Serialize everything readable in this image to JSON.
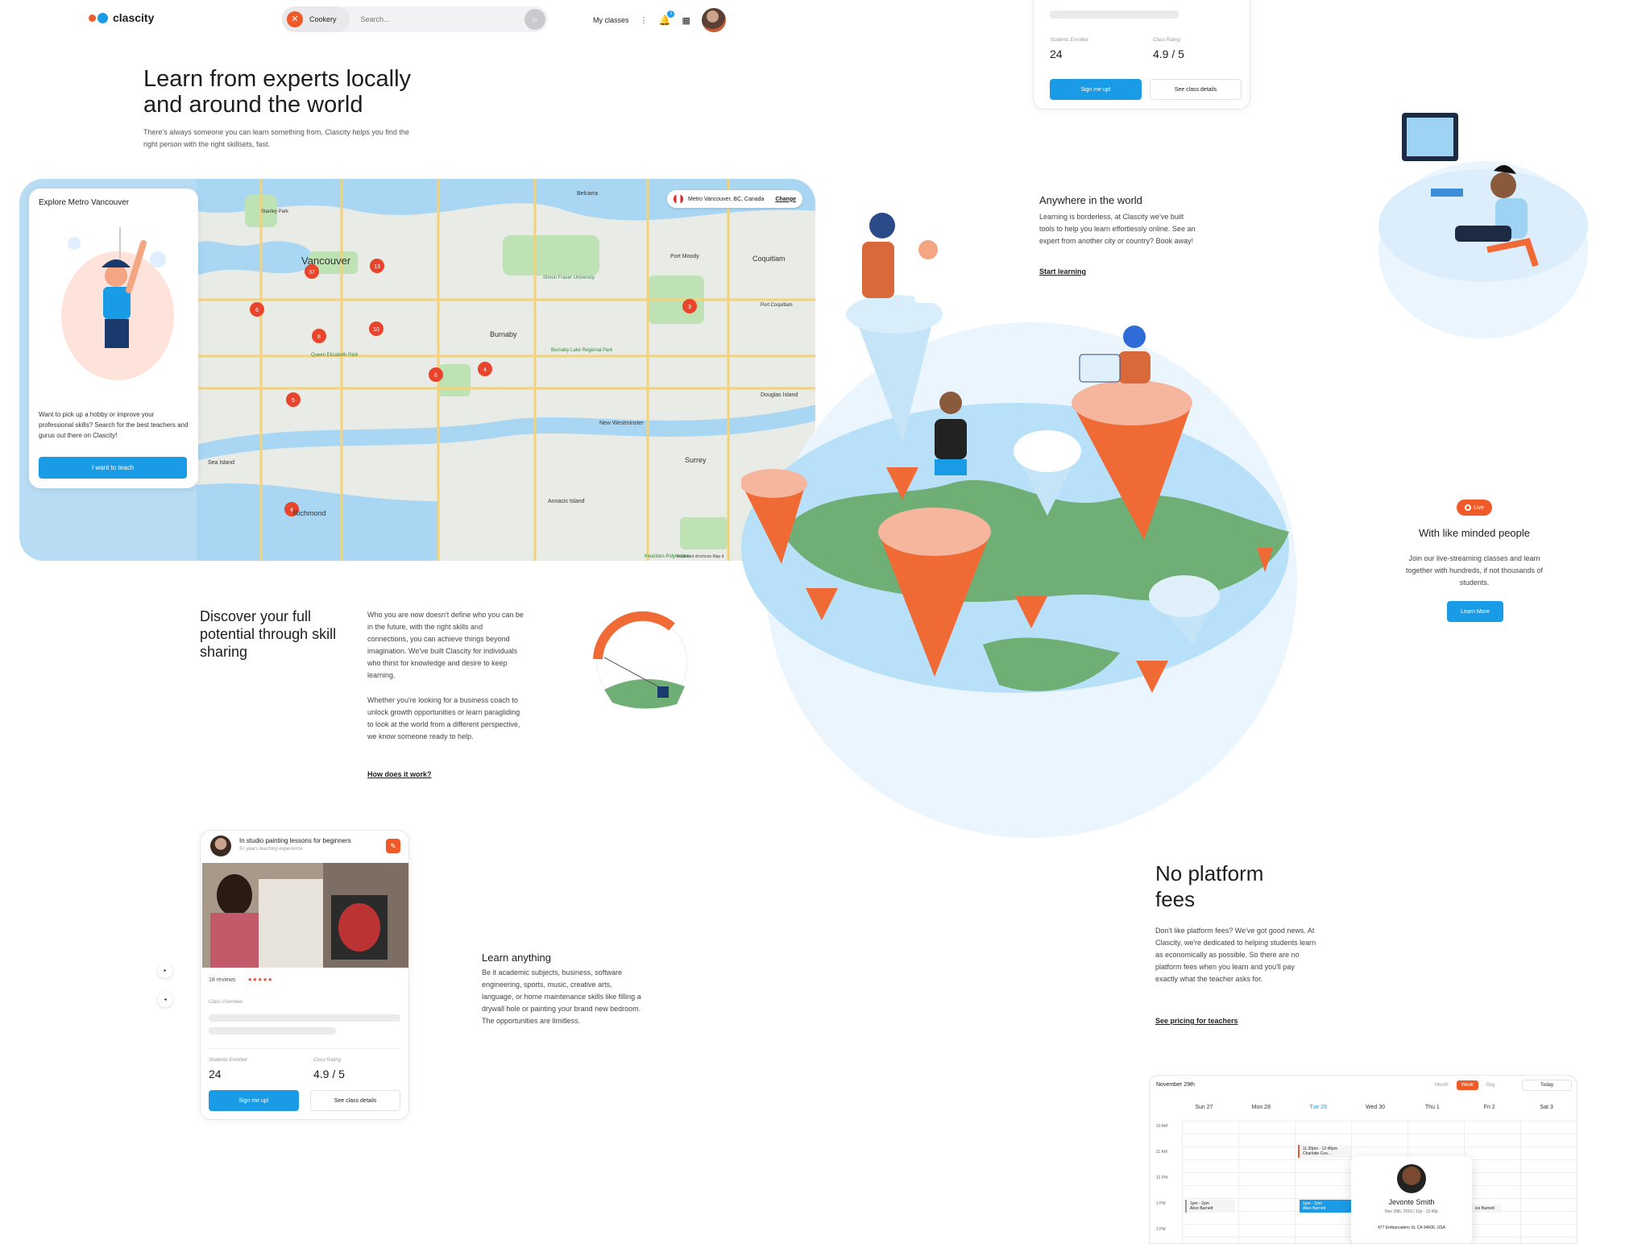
{
  "header": {
    "brand": "clascity",
    "category": "Cookery",
    "search_placeholder": "Search...",
    "my_classes": "My classes",
    "notification_count": "1"
  },
  "hero": {
    "title": "Learn from experts locally and around the world",
    "subtitle": "There's always someone you can learn something from, Clascity helps you find the right person with the right skillsets, fast."
  },
  "explore": {
    "title": "Explore Metro Vancouver",
    "text": "Want to pick up a hobby or improve your professional skills? Search for the best teachers and gurus out there on Clascity!",
    "button": "I want to teach"
  },
  "map": {
    "location": "Metro Vancouver, BC, Canada",
    "change": "Change",
    "footer": "Keyboard shortcuts   Map d",
    "places": [
      "Vancouver",
      "Burnaby",
      "Coquitlam",
      "Port Moody",
      "Richmond",
      "Surrey",
      "New Westminster",
      "Belcarra",
      "Port Coquitlam",
      "Sea Island",
      "Annacis Island",
      "Douglas Island",
      "Stanley Park",
      "Simon Fraser University",
      "Burnaby Lake Regional Park",
      "Queen Elizabeth Park",
      "Kwantlen Polytechnic"
    ],
    "markers": [
      "37",
      "13",
      "6",
      "8",
      "10",
      "6",
      "4",
      "3",
      "5",
      "4"
    ]
  },
  "discover": {
    "title": "Discover your full potential through skill sharing",
    "p1": "Who you are now doesn't define who you can be in the future, with the right skills and connections, you can achieve things beyond imagination. We've built Clascity for individuals who thirst for knowledge and desire to keep learning.",
    "p2": "Whether you're looking for a business coach to unlock growth opportunities or learn paragliding to look at the world from a different perspective, we know someone ready to help.",
    "link": "How does it work?"
  },
  "class_card": {
    "title": "In studio painting lessons for beginners",
    "experience": "5+ years teaching experience",
    "reviews": "18 reviews",
    "stars": "★★★★★",
    "overview_label": "Class Overview",
    "enrolled_label": "Students Enrolled",
    "enrolled": "24",
    "rating_label": "Class Rating",
    "rating": "4.9 / 5",
    "signup": "Sign me up!",
    "details": "See class details"
  },
  "learn": {
    "title": "Learn anything",
    "text": "Be it academic subjects, business, software engineering, sports, music, creative arts, language, or home maintenance skills like filling a drywall hole or painting your brand new bedroom. The opportunities are limitless."
  },
  "top_card": {
    "enrolled_label": "Students Enrolled",
    "enrolled": "24",
    "rating_label": "Class Rating",
    "rating": "4.9 / 5",
    "signup": "Sign me up!",
    "details": "See class details"
  },
  "anywhere": {
    "title": "Anywhere in the world",
    "text": "Learning is borderless, at Clascity we've built tools to help you learn effortlessly online. See an expert from another city or country? Book away!",
    "link": "Start learning"
  },
  "live": {
    "badge": "Live",
    "title": "With like minded people",
    "text": "Join our live-streaming classes and learn together with hundreds, if not thousands of students.",
    "button": "Learn More"
  },
  "fees": {
    "title": "No platform fees",
    "text": "Don't like platform fees? We've got good news. At Clascity, we're dedicated to helping students learn as economically as possible. So there are no platform fees when you learn and you'll pay exactly what the teacher asks for.",
    "link": "See pricing for teachers"
  },
  "calendar": {
    "date": "November 29th",
    "views": [
      "Month",
      "Week",
      "Day"
    ],
    "today": "Today",
    "days": [
      "Sun 27",
      "Mon 28",
      "Tue 29",
      "Wed 30",
      "Thu 1",
      "Fri 2",
      "Sat 3"
    ],
    "times": [
      "10 AM",
      "11 AM",
      "12 PM",
      "1 PM",
      "2 PM"
    ],
    "events": {
      "e1_time": "11:30pm - 12:45pm",
      "e1_name": "Charlotte Coo...",
      "e2_time": "1pm - 2pm",
      "e2_name": "Alice Barnett",
      "e3_time": "1pm - 2pm",
      "e3_name": "Alice Barnett",
      "e4_name": "ice Barnett"
    },
    "popup": {
      "name": "Jevonte Smith",
      "time": "Nov 29th, 2016 | 12p - 12:45p",
      "address": "477 Embarcadero St, CA 94606, USA"
    }
  },
  "colors": {
    "accent": "#1a9be6",
    "brand": "#f05a28"
  }
}
